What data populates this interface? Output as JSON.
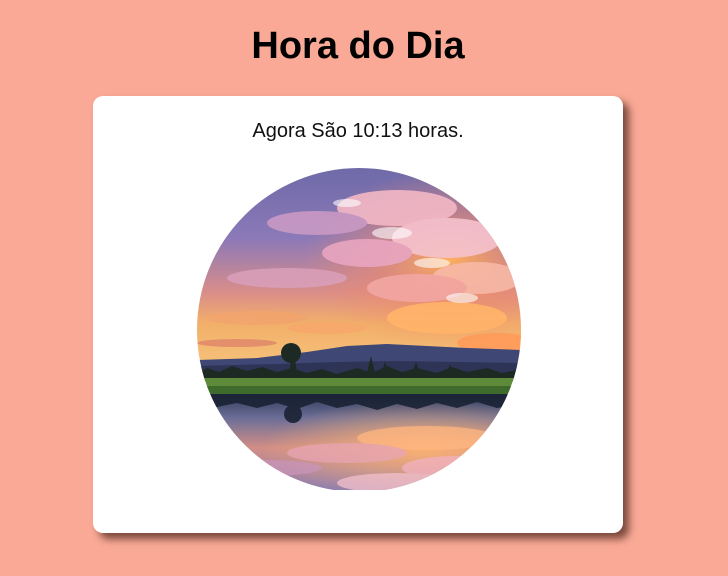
{
  "page": {
    "title": "Hora do Dia",
    "background_color": "#f9a996"
  },
  "card": {
    "time_text": "Agora São 10:13 horas.",
    "image": {
      "alt": "sunset-landscape-photo",
      "shape": "circle"
    }
  }
}
